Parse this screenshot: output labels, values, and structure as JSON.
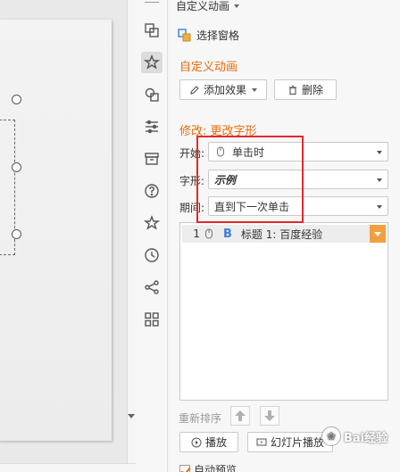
{
  "panel": {
    "title": "自定义动画",
    "selection_pane": "选择窗格",
    "section_title": "自定义动画",
    "add_effect": "添加效果",
    "delete": "删除",
    "modify_title": "修改: 更改字形",
    "start_label": "开始:",
    "start_value": "单击时",
    "font_label": "字形:",
    "font_value": "示例",
    "period_label": "期间:",
    "period_value": "直到下一次单击",
    "list_items": [
      {
        "number": "1",
        "letter": "B",
        "text": "标题 1: 百度经验"
      }
    ],
    "reorder": "重新排序",
    "play": "播放",
    "slideshow": "幻灯片播放",
    "auto_preview": "自动预览"
  },
  "toolbar": {
    "icons": [
      "replace-icon",
      "animation-icon",
      "shapes-icon",
      "sliders-icon",
      "archive-icon",
      "help-icon",
      "star-icon",
      "history-icon",
      "share-icon",
      "grid-icon"
    ]
  },
  "watermark": "Bai经验",
  "colors": {
    "accent": "#e46c0a",
    "highlight": "#e0292e",
    "item_letter": "#3b7dd8"
  }
}
